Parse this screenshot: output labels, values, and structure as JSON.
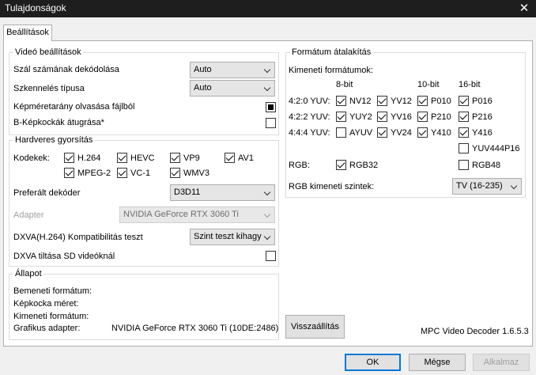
{
  "window": {
    "title": "Tulajdonságok",
    "close_glyph": "✕"
  },
  "tab": {
    "label": "Beállítások"
  },
  "video": {
    "legend": "Videó beállítások",
    "threads_label": "Szál számának dekódolása",
    "threads_value": "Auto",
    "scan_label": "Szkennelés típusa",
    "scan_value": "Auto",
    "aspect_label": "Képméretarány olvasása fájlból",
    "bskip_label": "B-Képkockák átugrása*"
  },
  "hw": {
    "legend": "Hardveres gyorsítás",
    "codecs_label": "Kodekek:",
    "codecs": [
      "H.264",
      "HEVC",
      "VP9",
      "AV1",
      "MPEG-2",
      "VC-1",
      "WMV3"
    ],
    "pref_label": "Preferált dekóder",
    "pref_value": "D3D11",
    "adapter_label": "Adapter",
    "adapter_value": "NVIDIA GeForce RTX 3060 Ti",
    "dxva_label": "DXVA(H.264) Kompatibilitás teszt",
    "dxva_value": "Szint teszt kihagyá",
    "sd_label": "DXVA tiltása SD videóknál"
  },
  "status": {
    "legend": "Állapot",
    "input_label": "Bemeneti formátum:",
    "frame_label": "Képkocka méret:",
    "output_label": "Kimeneti formátum:",
    "gpu_label": "Grafikus adapter:",
    "gpu_value": "NVIDIA GeForce RTX 3060 Ti (10DE:2486)"
  },
  "fmt": {
    "legend": "Formátum átalakítás",
    "outputs_label": "Kimeneti formátumok:",
    "headers": [
      "8-bit",
      "10-bit",
      "16-bit"
    ],
    "rows": [
      "4:2:0 YUV:",
      "4:2:2 YUV:",
      "4:4:4 YUV:"
    ],
    "c420": [
      "NV12",
      "YV12",
      "P010",
      "P016"
    ],
    "c422": [
      "YUY2",
      "YV16",
      "P210",
      "P216"
    ],
    "c444": [
      "AYUV",
      "YV24",
      "Y410",
      "Y416"
    ],
    "extra": "YUV444P16",
    "rgb_label": "RGB:",
    "rgb32": "RGB32",
    "rgb48": "RGB48",
    "levels_label": "RGB kimeneti szintek:",
    "levels_value": "TV (16-235)"
  },
  "footer": {
    "reset": "Visszaállítás",
    "version": "MPC Video Decoder 1.6.5.3",
    "ok": "OK",
    "cancel": "Mégse",
    "apply": "Alkalmaz"
  }
}
